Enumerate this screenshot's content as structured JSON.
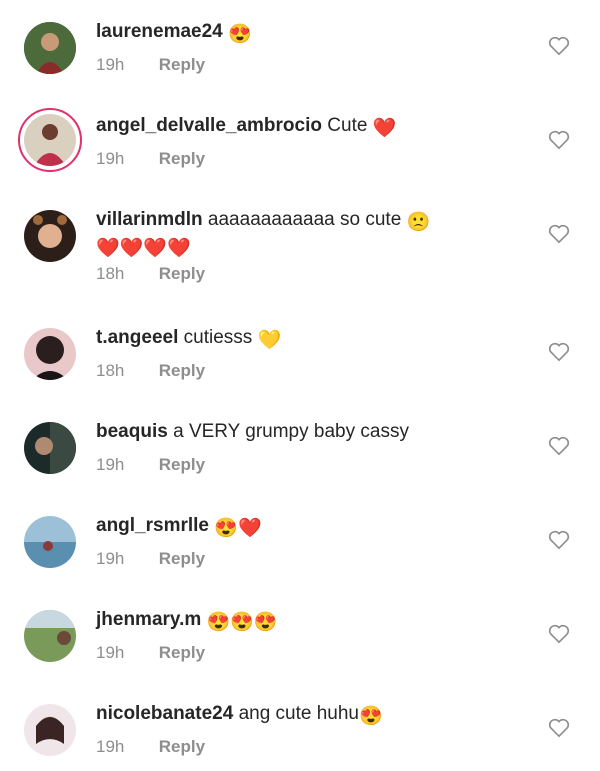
{
  "comments": [
    {
      "user": "laurenemae24",
      "text": "",
      "emoji": "😍",
      "time": "19h",
      "reply": "Reply"
    },
    {
      "user": "angel_delvalle_ambrocio",
      "text": "Cute",
      "emoji": "❤️",
      "time": "19h",
      "reply": "Reply"
    },
    {
      "user": "villarinmdln",
      "text": "aaaaaaaaaaaa so cute",
      "emoji": "🙁",
      "line2": "❤️❤️❤️❤️",
      "time": "18h",
      "reply": "Reply"
    },
    {
      "user": "t.angeeel",
      "text": "cutiesss",
      "emoji": "💛",
      "time": "18h",
      "reply": "Reply"
    },
    {
      "user": "beaquis",
      "text": "a VERY grumpy baby cassy",
      "emoji": "",
      "time": "19h",
      "reply": "Reply"
    },
    {
      "user": "angl_rsmrlle",
      "text": "",
      "emoji": "😍❤️",
      "time": "19h",
      "reply": "Reply"
    },
    {
      "user": "jhenmary.m",
      "text": "",
      "emoji": "😍😍😍",
      "time": "19h",
      "reply": "Reply"
    },
    {
      "user": "nicolebanate24",
      "text": "ang cute huhu",
      "emoji": "😍",
      "time": "19h",
      "reply": "Reply"
    }
  ],
  "colors": {
    "text": "#262626",
    "meta": "#8e8e8e",
    "story_ring": "#e1306c"
  },
  "icons": {
    "like": "heart-outline-icon"
  }
}
